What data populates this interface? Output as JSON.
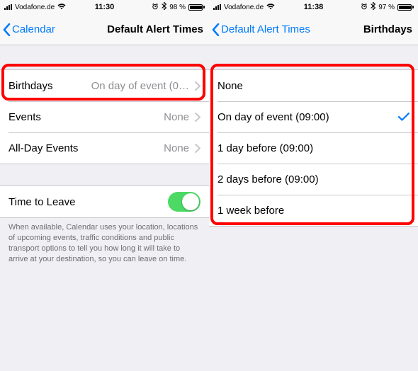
{
  "left": {
    "status": {
      "carrier": "Vodafone.de",
      "time": "11:30",
      "battery_pct": "98 %",
      "alarm": true,
      "bt": true
    },
    "nav": {
      "back_label": "Calendar",
      "title": "Default Alert Times"
    },
    "rows": {
      "birthdays": {
        "label": "Birthdays",
        "value": "On day of event (0…"
      },
      "events": {
        "label": "Events",
        "value": "None"
      },
      "allday": {
        "label": "All-Day Events",
        "value": "None"
      }
    },
    "ttl": {
      "label": "Time to Leave",
      "on": true
    },
    "footer": "When available, Calendar uses your location, locations of upcoming events, traffic conditions and public transport options to tell you how long it will take to arrive at your destination, so you can leave on time."
  },
  "right": {
    "status": {
      "carrier": "Vodafone.de",
      "time": "11:38",
      "battery_pct": "97 %",
      "alarm": true,
      "bt": true
    },
    "nav": {
      "back_label": "Default Alert Times",
      "title": "Birthdays"
    },
    "options": [
      {
        "label": "None",
        "selected": false
      },
      {
        "label": "On day of event (09:00)",
        "selected": true
      },
      {
        "label": "1 day before (09:00)",
        "selected": false
      },
      {
        "label": "2 days before (09:00)",
        "selected": false
      },
      {
        "label": "1 week before",
        "selected": false
      }
    ]
  }
}
